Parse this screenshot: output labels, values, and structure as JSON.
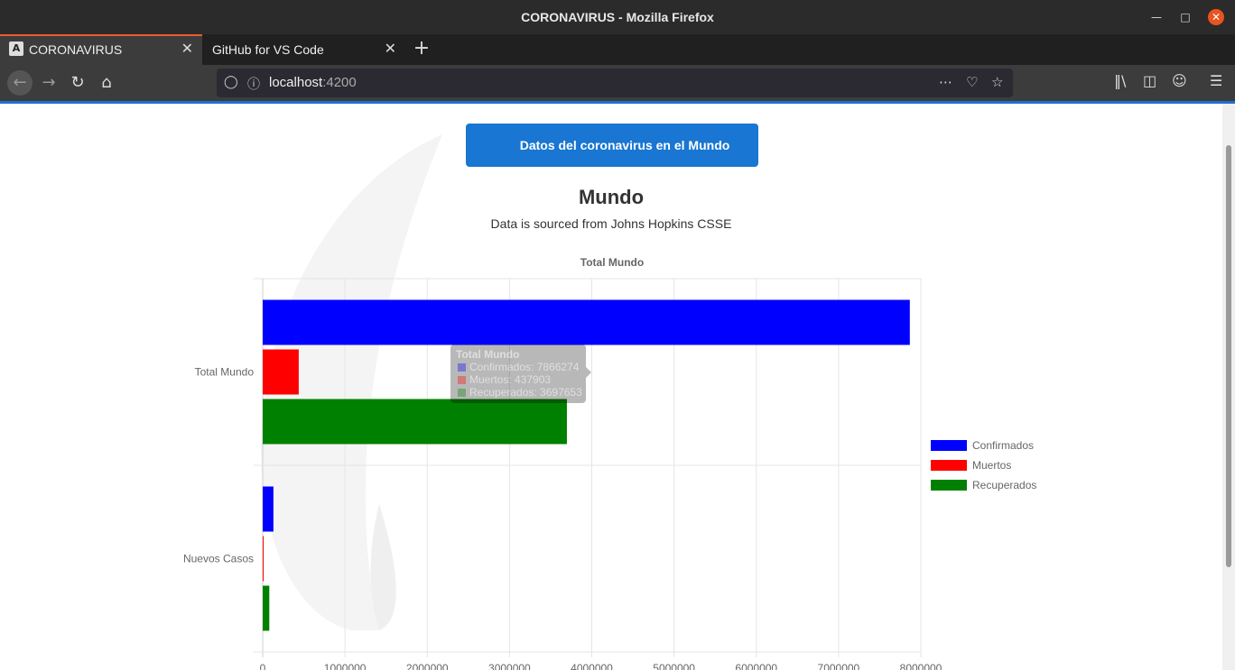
{
  "window": {
    "title": "CORONAVIRUS - Mozilla Firefox"
  },
  "tabs": [
    {
      "label": "CORONAVIRUS",
      "icon": "angular-icon",
      "active": true
    },
    {
      "label": "GitHub for VS Code",
      "active": false
    }
  ],
  "url": {
    "host": "localhost",
    "port": ":4200"
  },
  "page": {
    "button_label": "Datos del coronavirus en el Mundo",
    "title": "Mundo",
    "subtitle": "Data is sourced from Johns Hopkins CSSE"
  },
  "colors": {
    "confirmed": "#0000ff",
    "deaths": "#ff0000",
    "recovered": "#008000",
    "button": "#1976d2"
  },
  "tooltip": {
    "title": "Total Mundo",
    "lines": [
      "Confirmados: 7866274",
      "Muertos: 437903",
      "Recuperados: 3697653"
    ]
  },
  "chart_data": {
    "type": "bar",
    "orientation": "horizontal",
    "title": "Total Mundo",
    "categories": [
      "Total Mundo",
      "Nuevos Casos"
    ],
    "series": [
      {
        "name": "Confirmados",
        "color": "#0000ff",
        "values": [
          7866274,
          130000
        ]
      },
      {
        "name": "Muertos",
        "color": "#ff0000",
        "values": [
          437903,
          5000
        ]
      },
      {
        "name": "Recuperados",
        "color": "#008000",
        "values": [
          3697653,
          80000
        ]
      }
    ],
    "xlim": [
      0,
      8000000
    ],
    "xticks": [
      "0",
      "1000000",
      "2000000",
      "3000000",
      "4000000",
      "5000000",
      "6000000",
      "7000000",
      "8000000"
    ],
    "legend": "right",
    "grid": true
  }
}
